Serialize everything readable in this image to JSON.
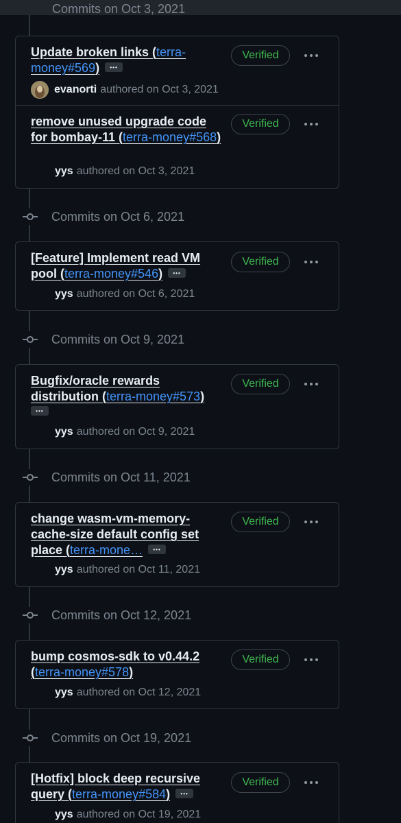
{
  "header_partial": "Commits on Oct 3, 2021",
  "verified_label": "Verified",
  "groups": [
    {
      "title": "Commits on Oct 3, 2021",
      "commits": [
        {
          "message": "Update broken links",
          "pr": "terra-money#569",
          "author": "evanorti",
          "authored": "authored on Oct 3, 2021"
        },
        {
          "message": "remove unused upgrade code for bombay-11",
          "pr": "terra-money#568",
          "author": "yys",
          "authored": "authored on Oct 3, 2021"
        }
      ]
    },
    {
      "title": "Commits on Oct 6, 2021",
      "commits": [
        {
          "message": "[Feature] Implement read VM pool",
          "pr": "terra-money#546",
          "author": "yys",
          "authored": "authored on Oct 6, 2021"
        }
      ]
    },
    {
      "title": "Commits on Oct 9, 2021",
      "commits": [
        {
          "message": "Bugfix/oracle rewards distribution",
          "pr": "terra-money#573",
          "author": "yys",
          "authored": "authored on Oct 9, 2021"
        }
      ]
    },
    {
      "title": "Commits on Oct 11, 2021",
      "commits": [
        {
          "message": "change wasm-vm-memory-cache-size default config set place",
          "pr": "terra-mone…",
          "author": "yys",
          "authored": "authored on Oct 11, 2021"
        }
      ]
    },
    {
      "title": "Commits on Oct 12, 2021",
      "commits": [
        {
          "message": "bump cosmos-sdk to v0.44.2",
          "pr": "terra-money#578",
          "author": "yys",
          "authored": "authored on Oct 12, 2021"
        }
      ]
    },
    {
      "title": "Commits on Oct 19, 2021",
      "commits": [
        {
          "message": "[Hotfix] block deep recursive query",
          "pr": "terra-money#584",
          "author": "yys",
          "authored": "authored on Oct 19, 2021"
        }
      ]
    }
  ]
}
